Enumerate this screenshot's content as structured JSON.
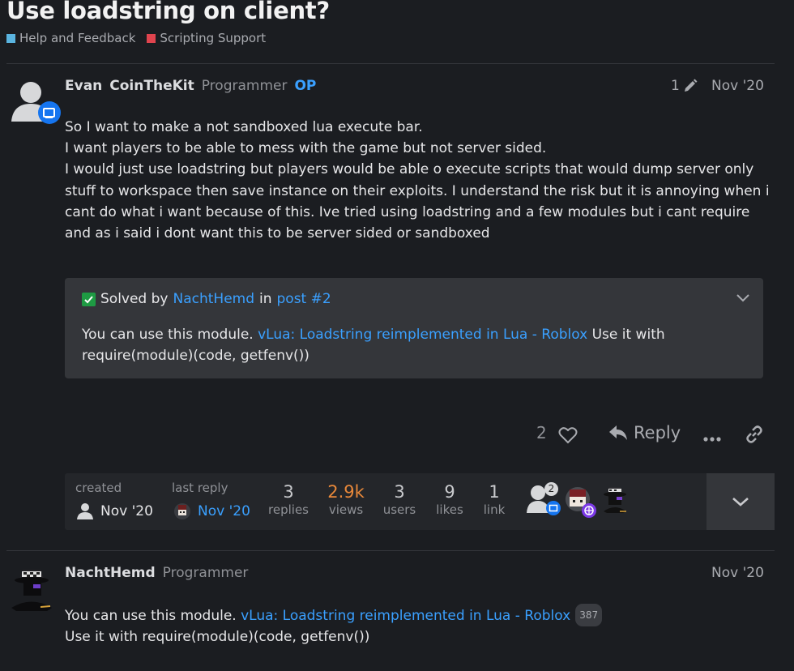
{
  "topic": {
    "title": "Use loadstring on client?",
    "categories": [
      {
        "label": "Help and Feedback",
        "color": "#5ab4e0"
      },
      {
        "label": "Scripting Support",
        "color": "#e0444e"
      }
    ]
  },
  "post1": {
    "username": "Evan",
    "display_name": "CoinTheKit",
    "role": "Programmer",
    "op": "OP",
    "edit_count": "1",
    "date": "Nov '20",
    "lines": [
      "So I want to make a not sandboxed lua execute bar.",
      "I want players to be able to mess with the game but not server sided.",
      "I would just use loadstring but players would be able o execute scripts that would dump server only stuff to workspace then save instance on their exploits. I understand the risk but it is annoying when i cant do what i want because of this. Ive tried using loadstring and a few modules but i cant require and as i said i dont want this to be server sided or sandboxed"
    ],
    "solution": {
      "solved_by_label": "Solved by",
      "solver": "NachtHemd",
      "in_label": "in",
      "post_link": "post #2",
      "text_before": "You can use this module. ",
      "link": "vLua: Loadstring reimplemented in Lua - Roblox",
      "text_after": " Use it with require(module)(code, getfenv())"
    },
    "likes": "2",
    "reply_label": "Reply"
  },
  "stats": {
    "created_label": "created",
    "created_date": "Nov '20",
    "last_reply_label": "last reply",
    "last_reply_date": "Nov '20",
    "replies": {
      "n": "3",
      "label": "replies"
    },
    "views": {
      "n": "2.9k",
      "label": "views"
    },
    "users": {
      "n": "3",
      "label": "users"
    },
    "likes": {
      "n": "9",
      "label": "likes"
    },
    "links": {
      "n": "1",
      "label": "link"
    },
    "participant_count": "2"
  },
  "post2": {
    "username": "NachtHemd",
    "role": "Programmer",
    "date": "Nov '20",
    "text_before": "You can use this module. ",
    "link": "vLua: Loadstring reimplemented in Lua - Roblox",
    "click_count": "387",
    "line2": "Use it with require(module)(code, getfenv())"
  },
  "colors": {
    "background": "#1b1d21",
    "link": "#3aa0ff",
    "views_hot": "#e8883a",
    "solved_check": "#1e9b43"
  }
}
